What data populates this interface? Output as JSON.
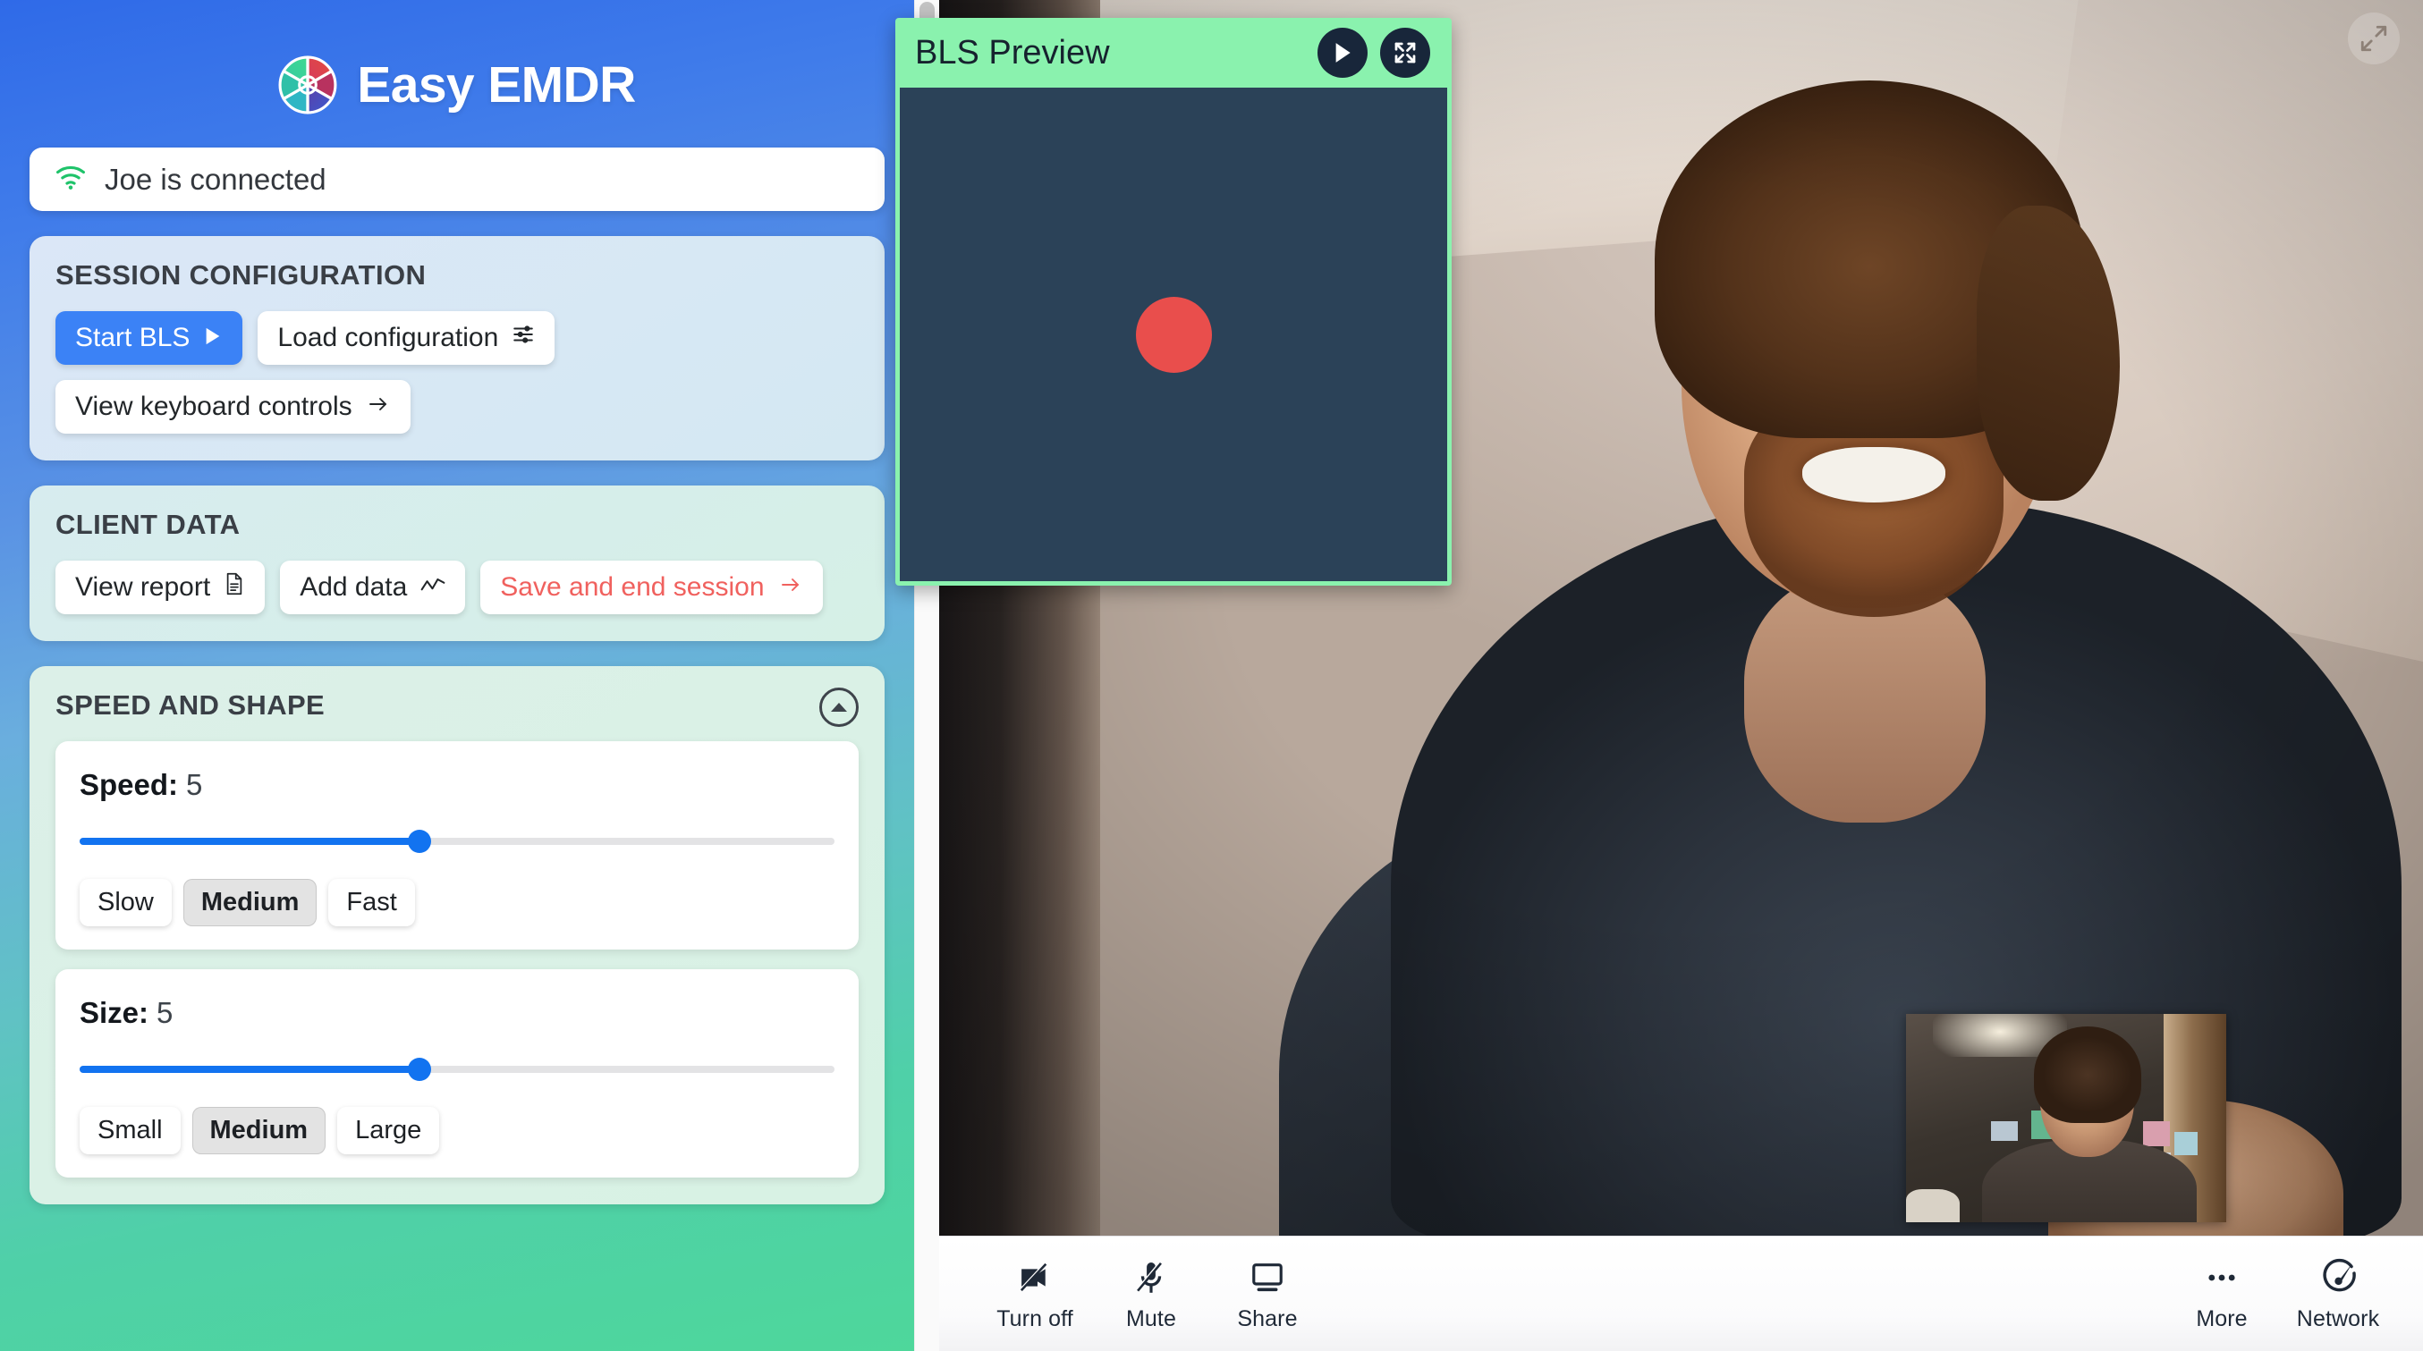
{
  "brand": {
    "title": "Easy EMDR",
    "logo_icon": "aperture-logo-icon"
  },
  "status": {
    "icon": "wifi-icon",
    "text": "Joe is connected",
    "icon_color": "#1fc36a"
  },
  "session_config": {
    "title": "SESSION CONFIGURATION",
    "start_bls": {
      "label": "Start BLS",
      "icon": "play-triangle-icon"
    },
    "load_config": {
      "label": "Load configuration",
      "icon": "sliders-icon"
    },
    "keyboard_controls": {
      "label": "View keyboard controls",
      "icon": "arrow-right-icon"
    },
    "accent_color": "#3b82f6"
  },
  "client_data": {
    "title": "CLIENT DATA",
    "view_report": {
      "label": "View report",
      "icon": "document-icon"
    },
    "add_data": {
      "label": "Add data",
      "icon": "line-chart-icon"
    },
    "save_end": {
      "label": "Save and end session",
      "icon": "arrow-right-icon",
      "color": "#f0615e"
    }
  },
  "speed_shape": {
    "title": "SPEED AND SHAPE",
    "collapse_icon": "chevron-up-circle-icon",
    "speed": {
      "label": "Speed:",
      "value": "5",
      "slider_percent": 45,
      "presets": [
        "Slow",
        "Medium",
        "Fast"
      ],
      "selected_preset": "Medium"
    },
    "size": {
      "label": "Size:",
      "value": "5",
      "slider_percent": 45,
      "presets": [
        "Small",
        "Medium",
        "Large"
      ],
      "selected_preset": "Medium"
    }
  },
  "bls_preview": {
    "title": "BLS Preview",
    "play_icon": "play-icon",
    "fullscreen_icon": "expand-arrows-icon",
    "header_color": "#8af2ae",
    "canvas_color": "#2b4258",
    "dot_color": "#e94e4c"
  },
  "call": {
    "expand_icon": "expand-diagonal-icon",
    "left_buttons": [
      {
        "label": "Turn off",
        "icon": "video-off-icon"
      },
      {
        "label": "Mute",
        "icon": "mic-off-icon"
      },
      {
        "label": "Share",
        "icon": "screen-share-icon"
      }
    ],
    "right_buttons": [
      {
        "label": "More",
        "icon": "ellipsis-icon"
      },
      {
        "label": "Network",
        "icon": "gauge-icon"
      }
    ]
  }
}
